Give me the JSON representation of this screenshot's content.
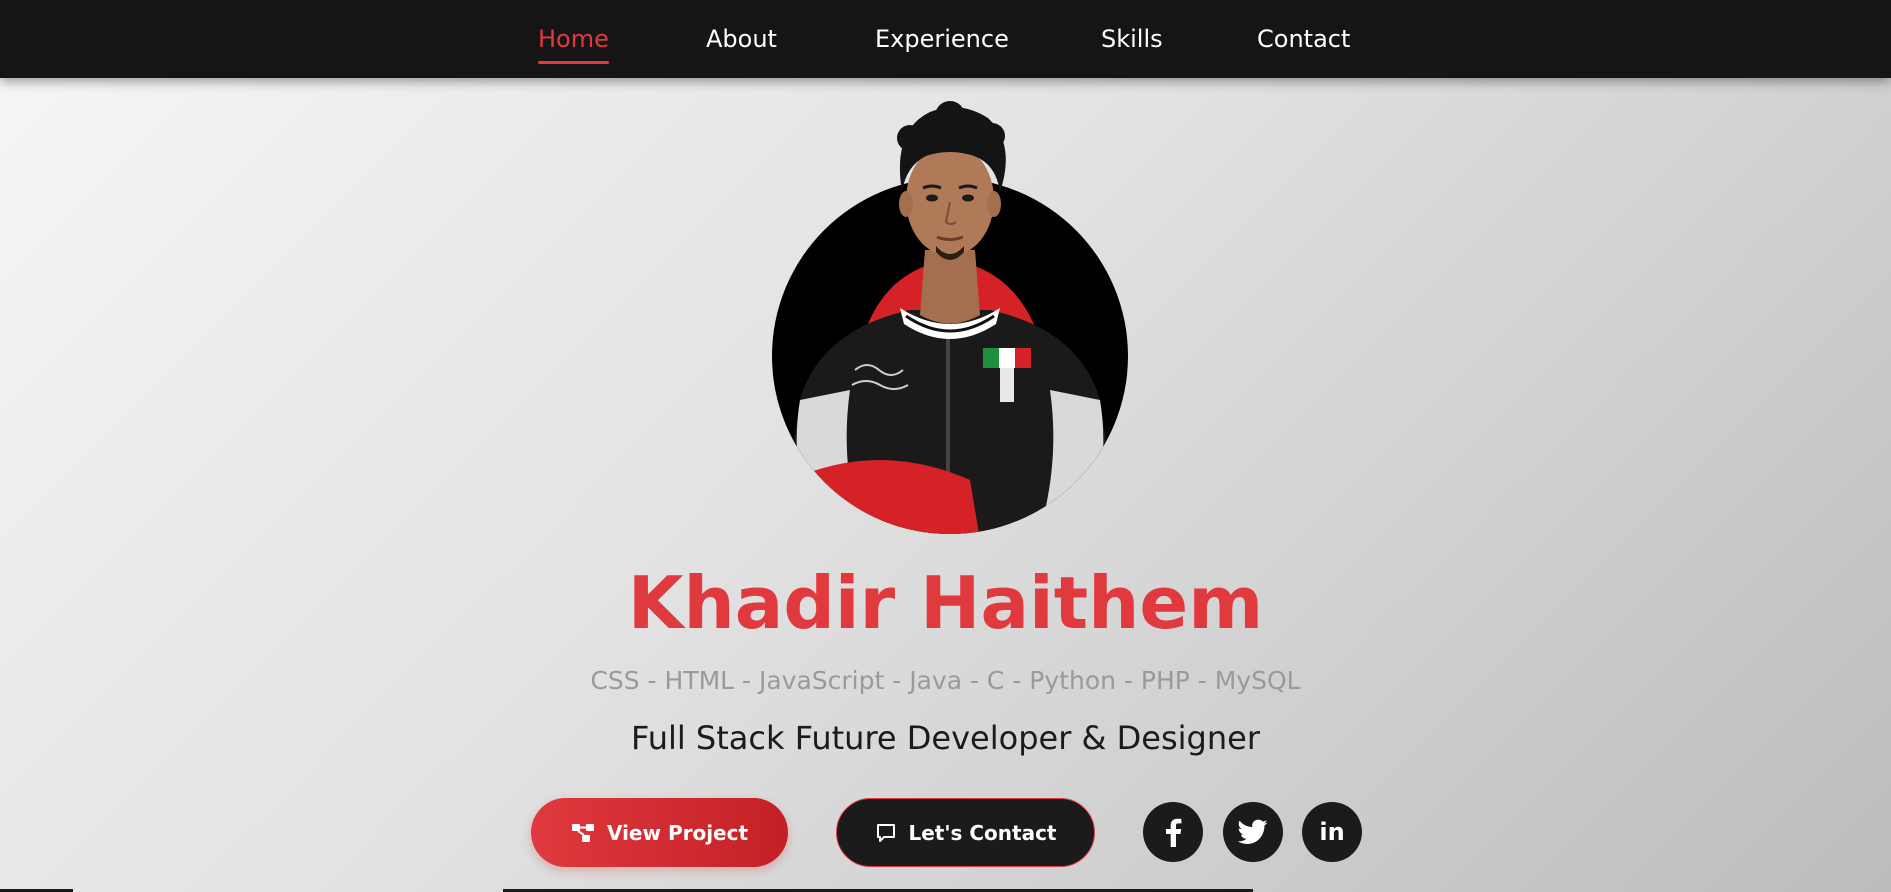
{
  "nav": {
    "items": [
      {
        "label": "Home",
        "active": true
      },
      {
        "label": "About",
        "active": false
      },
      {
        "label": "Experience",
        "active": false
      },
      {
        "label": "Skills",
        "active": false
      },
      {
        "label": "Contact",
        "active": false
      }
    ]
  },
  "hero": {
    "name": "Khadir Haithem",
    "skills": "CSS - HTML - JavaScript - Java - C - Python - PHP - MySQL",
    "tagline": "Full Stack Future Developer & Designer",
    "buttons": {
      "view_project": "View Project",
      "lets_contact": "Let's Contact"
    },
    "social": {
      "linkedin_text": "in"
    }
  },
  "icons": {
    "view_project": "project-tree-icon",
    "lets_contact": "chat-bubble-icon",
    "facebook": "facebook-icon",
    "twitter": "twitter-icon",
    "linkedin": "linkedin-icon"
  },
  "colors": {
    "accent": "#e0393e",
    "nav_bg": "#151515",
    "dark_button": "#1b1b1b",
    "skills_text": "#9a9a9a"
  }
}
